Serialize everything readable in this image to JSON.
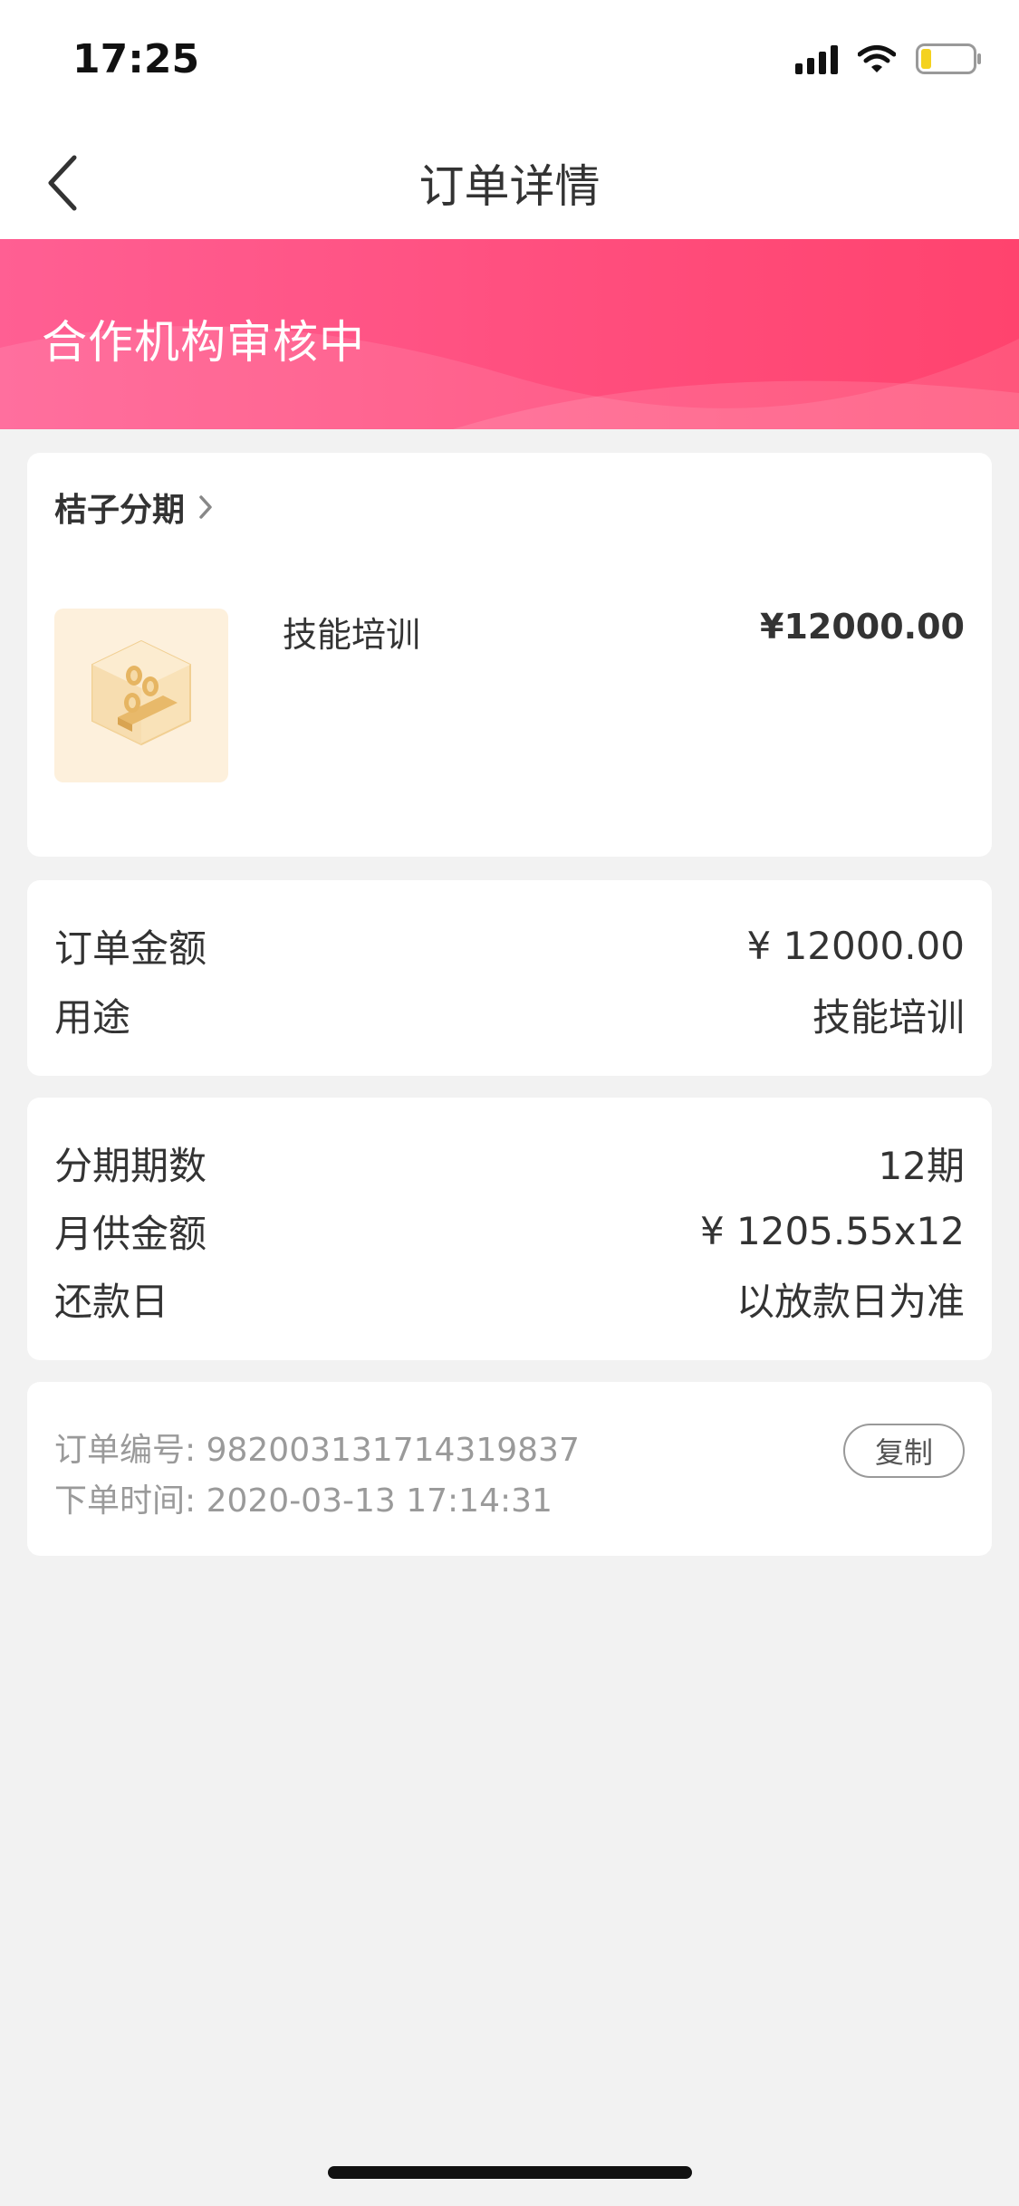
{
  "status_bar": {
    "time": "17:25"
  },
  "nav": {
    "title": "订单详情"
  },
  "banner": {
    "status_text": "合作机构审核中"
  },
  "product_card": {
    "merchant_name": "桔子分期",
    "product_name": "技能培训",
    "price": "¥12000.00"
  },
  "amount_card": {
    "rows": [
      {
        "label": "订单金额",
        "value": "¥ 12000.00"
      },
      {
        "label": "用途",
        "value": "技能培训"
      }
    ]
  },
  "installment_card": {
    "rows": [
      {
        "label": "分期期数",
        "value": "12期"
      },
      {
        "label": "月供金额",
        "value": "¥ 1205.55x12"
      },
      {
        "label": "还款日",
        "value": "以放款日为准"
      }
    ]
  },
  "order_card": {
    "order_number": "订单编号: 982003131714319837",
    "order_time": "下单时间: 2020-03-13 17:14:31",
    "copy_label": "复制"
  },
  "colors": {
    "accent": "#ff4d7c",
    "background": "#f2f2f2",
    "text_primary": "#333333",
    "text_secondary": "#9a9a9a"
  }
}
